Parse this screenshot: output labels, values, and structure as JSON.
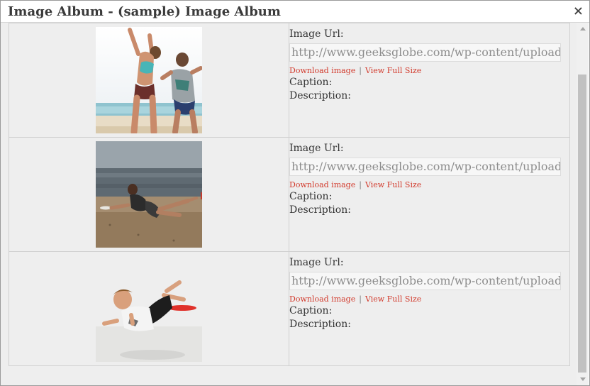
{
  "dialog": {
    "title": "Image Album - (sample) Image Album",
    "close_glyph": "×"
  },
  "labels": {
    "image_url": "Image Url:",
    "download": "Download image",
    "separator": "|",
    "view_full": "View Full Size",
    "caption": "Caption:",
    "description": "Description:"
  },
  "rows": [
    {
      "image": "beach-volleyball-women-photo",
      "url": "http://www.geeksglobe.com/wp-content/uploads/"
    },
    {
      "image": "woman-diving-frisbee-beach-photo",
      "url": "http://www.geeksglobe.com/wp-content/uploads/"
    },
    {
      "image": "boy-diving-frisbee-photo",
      "url": "http://www.geeksglobe.com/wp-content/uploads/"
    }
  ]
}
